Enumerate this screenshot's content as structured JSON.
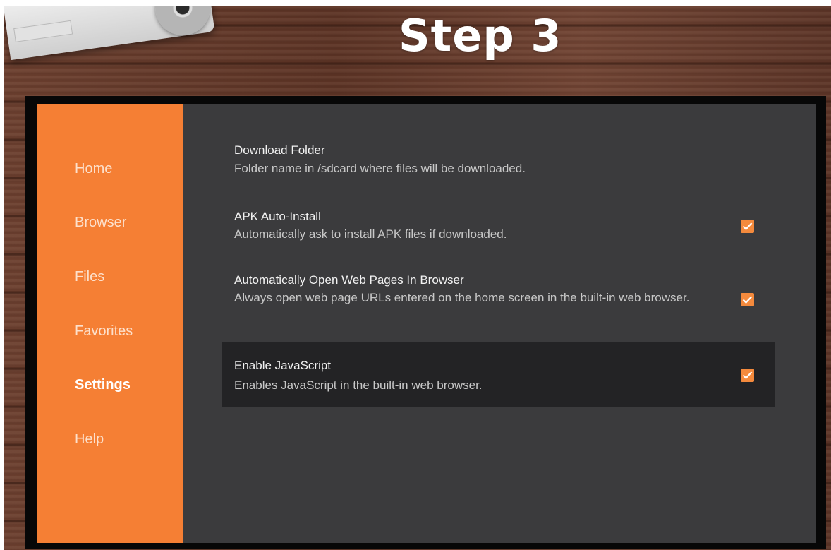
{
  "overlay": {
    "title": "Step 3"
  },
  "sidebar": {
    "items": [
      {
        "label": "Home"
      },
      {
        "label": "Browser"
      },
      {
        "label": "Files"
      },
      {
        "label": "Favorites"
      },
      {
        "label": "Settings",
        "active": true
      },
      {
        "label": "Help"
      }
    ]
  },
  "settings": {
    "rows": [
      {
        "title": "Download Folder",
        "description": "Folder name in /sdcard where files will be downloaded."
      },
      {
        "title": "APK Auto-Install",
        "description": "Automatically ask to install APK files if downloaded.",
        "checked": true
      },
      {
        "title": "Automatically Open Web Pages In Browser",
        "description": "Always open web page URLs entered on the home screen in the built-in web browser.",
        "checked": true
      },
      {
        "title": "Enable JavaScript",
        "description": "Enables JavaScript in the built-in web browser.",
        "checked": true,
        "selected": true
      }
    ]
  },
  "colors": {
    "sidebar": "#f57f34",
    "content": "#3b3b3d",
    "checkbox": "#f48a3d",
    "selected_row": "#232325"
  },
  "icons": {
    "check": "checkmark-icon"
  }
}
